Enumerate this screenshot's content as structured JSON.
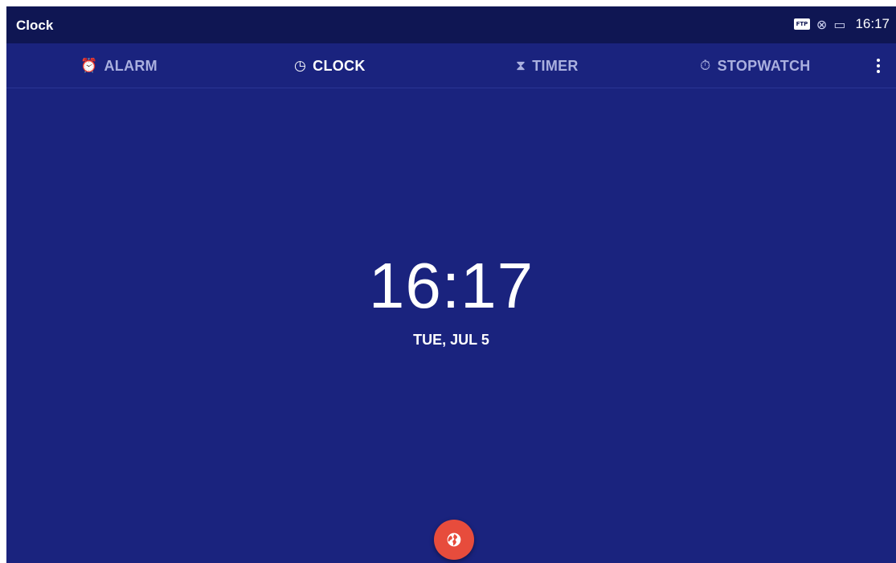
{
  "status_bar": {
    "app_title": "Clock",
    "ftp_label": "FTP",
    "time": "16:17"
  },
  "tabs": [
    {
      "label": "ALARM",
      "icon": "alarm-icon",
      "glyph": "⏰",
      "active": false
    },
    {
      "label": "CLOCK",
      "icon": "clock-icon",
      "glyph": "◷",
      "active": true
    },
    {
      "label": "TIMER",
      "icon": "hourglass-icon",
      "glyph": "⧗",
      "active": false
    },
    {
      "label": "STOPWATCH",
      "icon": "stopwatch-icon",
      "glyph": "⏱",
      "active": false
    }
  ],
  "clock": {
    "time": "16:17",
    "date": "TUE, JUL 5"
  },
  "fab": {
    "icon": "globe-icon"
  },
  "colors": {
    "background": "#1a237e",
    "status_bar": "#0f1653",
    "fab": "#e74c3c",
    "inactive_tab": "#aab0df"
  }
}
